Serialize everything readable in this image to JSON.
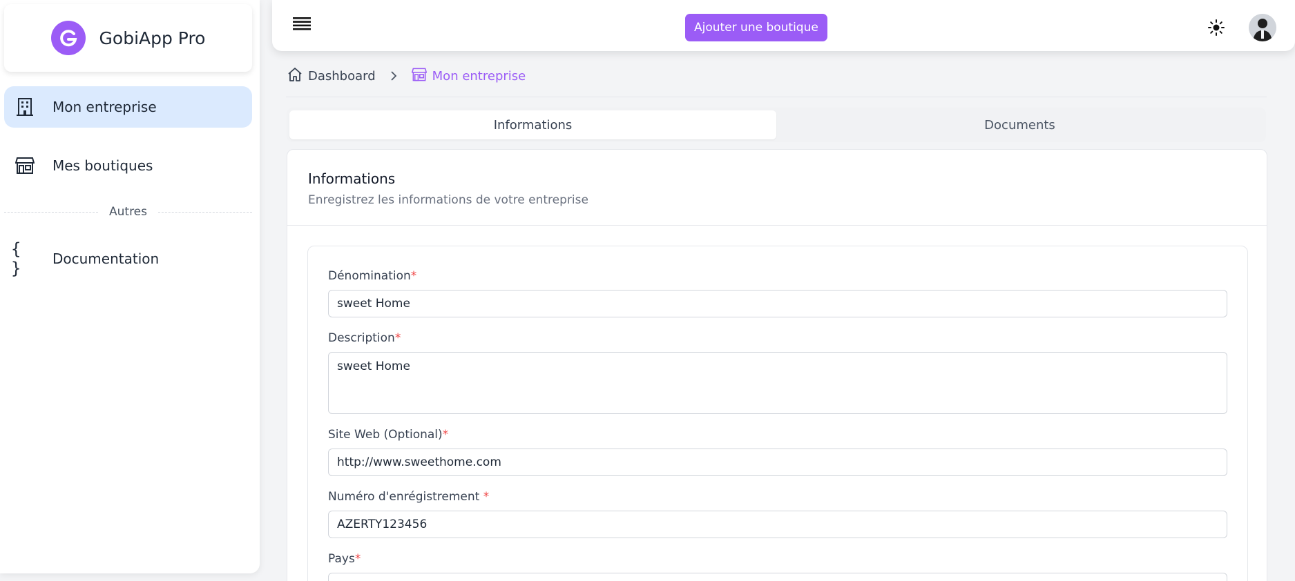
{
  "brand": {
    "name": "GobiApp Pro",
    "accent": "#9b5cf6"
  },
  "sidebar": {
    "items": [
      {
        "label": "Mon entreprise",
        "icon": "building-icon",
        "active": true
      },
      {
        "label": "Mes boutiques",
        "icon": "store-icon",
        "active": false
      }
    ],
    "section_label": "Autres",
    "other_items": [
      {
        "label": "Documentation",
        "icon": "code-braces-icon"
      }
    ]
  },
  "topbar": {
    "add_shop_label": "Ajouter une boutique"
  },
  "breadcrumb": [
    {
      "label": "Dashboard",
      "icon": "home-icon"
    },
    {
      "label": "Mon entreprise",
      "icon": "store-icon"
    }
  ],
  "tabs": [
    {
      "label": "Informations",
      "active": true
    },
    {
      "label": "Documents",
      "active": false
    }
  ],
  "card": {
    "title": "Informations",
    "subtitle": "Enregistrez les informations de votre entreprise"
  },
  "form": {
    "denomination": {
      "label": "Dénomination",
      "value": "sweet Home"
    },
    "description": {
      "label": "Description",
      "value": "sweet Home"
    },
    "website": {
      "label": "Site Web (Optional)",
      "value": "http://www.sweethome.com"
    },
    "registration": {
      "label": "Numéro d'enrégistrement ",
      "value": "AZERTY123456"
    },
    "country": {
      "label": "Pays",
      "value": ""
    },
    "required_mark": "*"
  }
}
